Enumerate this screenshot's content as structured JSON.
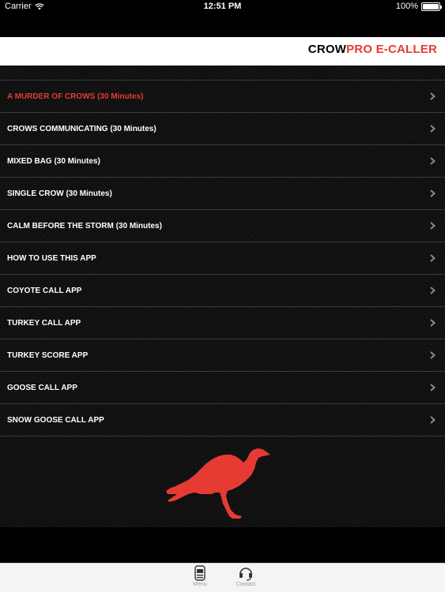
{
  "status_bar": {
    "carrier": "Carrier",
    "time": "12:51 PM",
    "battery": "100%"
  },
  "header": {
    "title_part1": "CROW",
    "title_part2": "PRO E-CALLER"
  },
  "menu": {
    "items": [
      {
        "label": "A MURDER OF CROWS (30 Minutes)",
        "active": true
      },
      {
        "label": "CROWS COMMUNICATING (30 Minutes)"
      },
      {
        "label": "MIXED BAG (30 Minutes)"
      },
      {
        "label": "SINGLE CROW (30 Minutes)"
      },
      {
        "label": "CALM BEFORE THE STORM (30 Minutes)"
      },
      {
        "label": "HOW TO USE THIS APP"
      },
      {
        "label": "COYOTE CALL APP"
      },
      {
        "label": "TURKEY CALL APP"
      },
      {
        "label": "TURKEY SCORE APP"
      },
      {
        "label": "GOOSE CALL APP"
      },
      {
        "label": "SNOW GOOSE CALL APP"
      }
    ]
  },
  "tabs": [
    {
      "label": "Menu",
      "icon": "jukebox-icon"
    },
    {
      "label": "Contact",
      "icon": "headset-icon"
    }
  ],
  "colors": {
    "accent": "#e53b33",
    "background": "#000000",
    "header_bg": "#ffffff"
  }
}
